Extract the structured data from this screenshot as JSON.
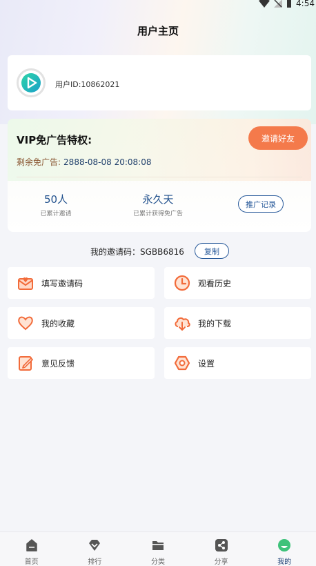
{
  "status_bar": {
    "time": "4:54"
  },
  "header": {
    "title": "用户主页"
  },
  "user": {
    "id_text": "用户ID:10862021"
  },
  "vip": {
    "title": "VIP免广告特权:",
    "invite_button": "邀请好友",
    "remain_label": "剩余免广告:",
    "remain_value": "2888-08-08 20:08:08",
    "stats": [
      {
        "value": "50人",
        "label": "已累计邀请"
      },
      {
        "value": "永久天",
        "label": "已累计获得免广告"
      }
    ],
    "promo_button": "推广记录"
  },
  "invite_code": {
    "text": "我的邀请码：SGBB6816",
    "copy_button": "复制"
  },
  "menu": [
    {
      "label": "填写邀请码",
      "icon": "mail-heart-icon"
    },
    {
      "label": "观看历史",
      "icon": "clock-icon"
    },
    {
      "label": "我的收藏",
      "icon": "heart-icon"
    },
    {
      "label": "我的下载",
      "icon": "cloud-download-icon"
    },
    {
      "label": "意见反馈",
      "icon": "edit-feedback-icon"
    },
    {
      "label": "设置",
      "icon": "hexagon-settings-icon"
    }
  ],
  "tabs": [
    {
      "label": "首页",
      "icon": "home-icon"
    },
    {
      "label": "排行",
      "icon": "diamond-icon"
    },
    {
      "label": "分类",
      "icon": "folder-icon"
    },
    {
      "label": "分享",
      "icon": "share-icon"
    },
    {
      "label": "我的",
      "icon": "profile-icon",
      "active": true
    }
  ],
  "colors": {
    "accent_orange": "#f47a4b",
    "primary_blue": "#2a5b9b",
    "active_green": "#3ec27a"
  }
}
